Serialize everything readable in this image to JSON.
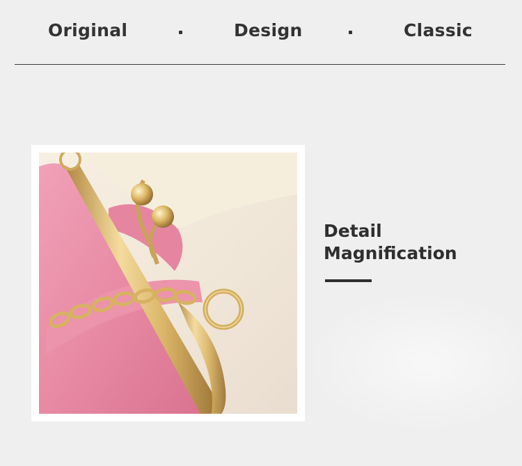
{
  "header": {
    "words": [
      "Original",
      "Design",
      "Classic"
    ],
    "separator": "·"
  },
  "detail": {
    "line1": "Detail",
    "line2": "Magnification"
  },
  "photo": {
    "subject": "pink-handbag-clasp-closeup",
    "colors": {
      "leather": "#e98aa5",
      "gold": "#d8b46a",
      "backdrop": "#f3ece2"
    }
  }
}
